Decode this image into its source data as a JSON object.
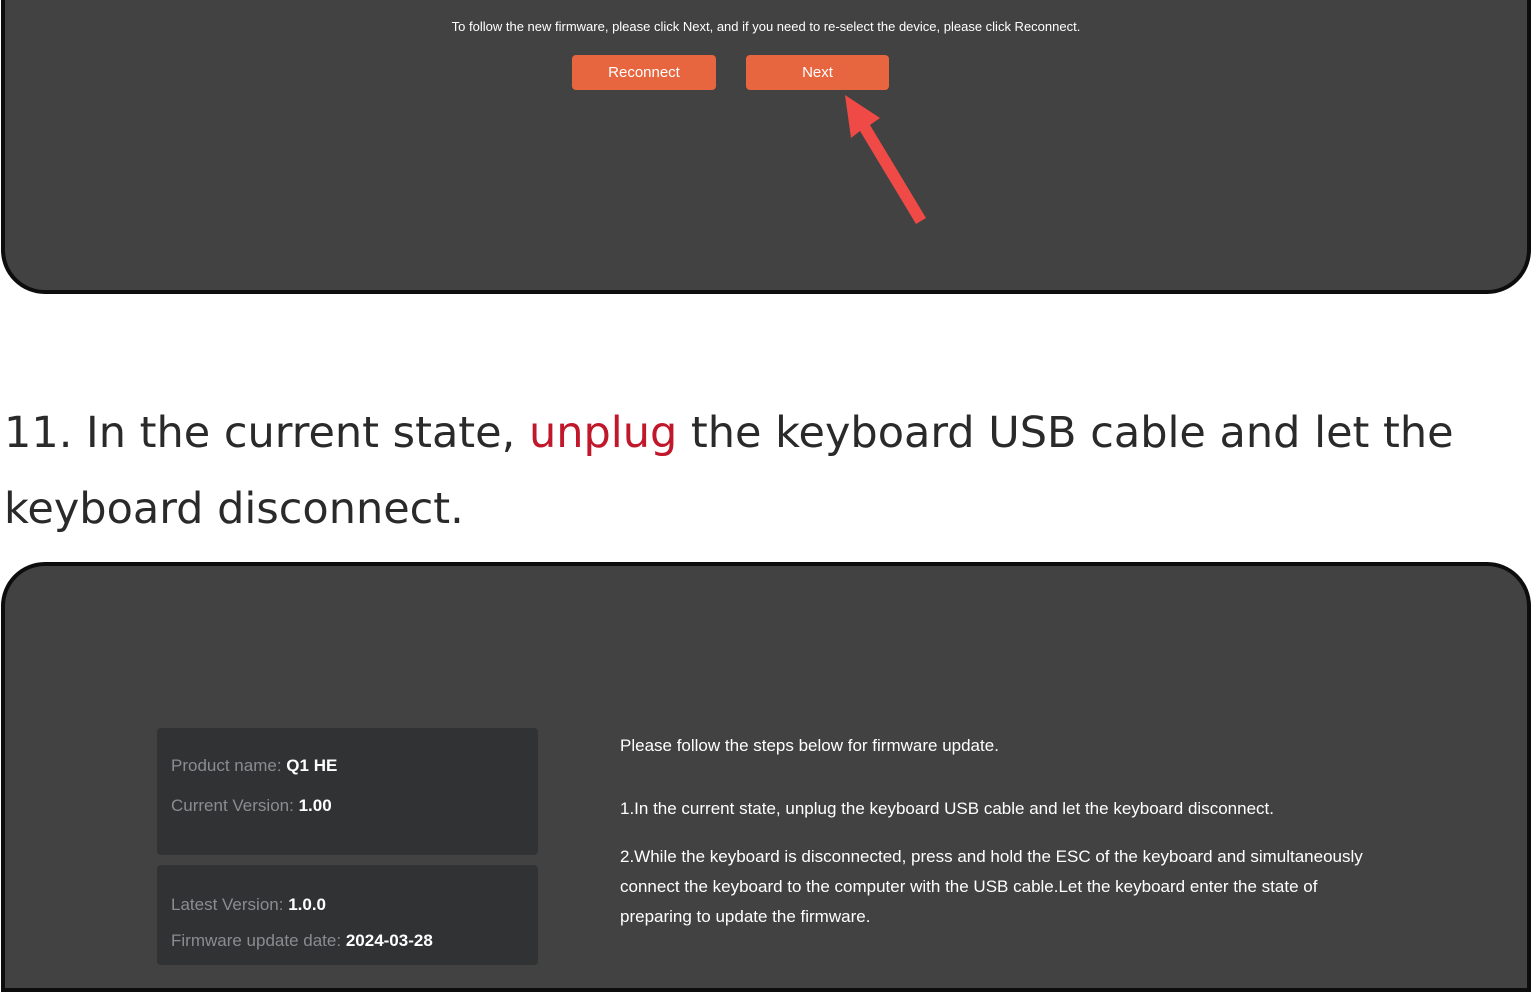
{
  "top_panel": {
    "instruction": "To follow the new firmware, please click Next, and if you need to re-select the device, please click Reconnect.",
    "reconnect_label": "Reconnect",
    "next_label": "Next"
  },
  "step": {
    "prefix": "11. In the current state, ",
    "highlight": "unplug",
    "suffix": " the keyboard USB cable and let the keyboard disconnect."
  },
  "device_card": {
    "product_name_label": "Product name:",
    "product_name_value": "Q1 HE",
    "current_version_label": "Current Version:",
    "current_version_value": "1.00"
  },
  "latest_card": {
    "latest_version_label": "Latest Version:",
    "latest_version_value": "1.0.0",
    "update_date_label": "Firmware update date:",
    "update_date_value": "2024-03-28"
  },
  "instructions": {
    "intro": "Please follow the steps below for firmware update.",
    "step1": "1.In the current state, unplug the keyboard USB cable and let the keyboard disconnect.",
    "step2": "2.While the keyboard is disconnected, press and hold the ESC of the keyboard and simultaneously connect the keyboard to the computer with the USB cable.Let the keyboard enter the state of preparing to update the firmware."
  },
  "colors": {
    "panel_bg": "#424242",
    "button_bg": "#e8663f",
    "arrow": "#f04a46",
    "highlight": "#c0172b"
  }
}
